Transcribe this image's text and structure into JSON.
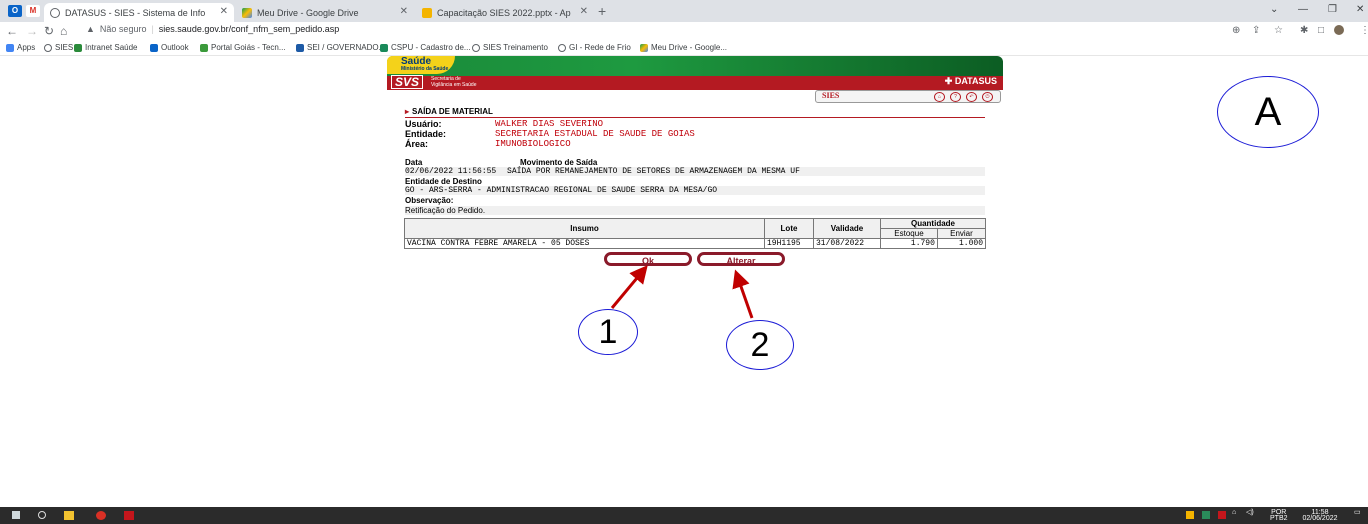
{
  "browser": {
    "tabs": [
      {
        "label": "DATASUS - SIES - Sistema de Info",
        "active": true
      },
      {
        "label": "Meu Drive - Google Drive",
        "active": false
      },
      {
        "label": "Capacitação SIES 2022.pptx - Ap",
        "active": false
      }
    ],
    "security_label": "Não seguro",
    "url": "sies.saude.gov.br/conf_nfm_sem_pedido.asp",
    "bookmarks": [
      "Apps",
      "SIES",
      "Intranet Saúde",
      "Outlook",
      "Portal Goiás - Tecn...",
      "SEI / GOVERNADO...",
      "CSPU - Cadastro de...",
      "SIES Treinamento",
      "GI - Rede de Frio",
      "Meu Drive - Google..."
    ]
  },
  "header": {
    "saude": "Saúde",
    "ministerio": "Ministério da Saúde",
    "svs": "SVS",
    "secretaria": "Secretaria de Vigilância em Saúde",
    "datasus": "DATASUS",
    "sies": "SIES"
  },
  "page": {
    "section_title": "SAÍDA DE MATERIAL",
    "usuario_label": "Usuário:",
    "usuario_value": "WALKER DIAS SEVERINO",
    "entidade_label": "Entidade:",
    "entidade_value": "SECRETARIA ESTADUAL DE SAUDE DE GOIAS",
    "area_label": "Área:",
    "area_value": "IMUNOBIOLOGICO",
    "data_label": "Data",
    "movimento_label": "Movimento de Saída",
    "data_value": "02/06/2022 11:56:55",
    "movimento_value": "SAÍDA POR REMANEJAMENTO DE SETORES DE ARMAZENAGEM DA MESMA UF",
    "destino_label": "Entidade de Destino",
    "destino_value": "GO - ARS-SERRA - ADMINISTRACAO REGIONAL DE SAUDE SERRA DA MESA/GO",
    "observacao_label": "Observação:",
    "observacao_value": "Retificação do Pedido.",
    "table": {
      "headers": {
        "insumo": "Insumo",
        "lote": "Lote",
        "validade": "Validade",
        "quantidade": "Quantidade",
        "estoque": "Estoque",
        "enviar": "Enviar"
      },
      "rows": [
        {
          "insumo": "VACINA CONTRA FEBRE AMARELA - 05 DOSES",
          "lote": "19H1195",
          "validade": "31/08/2022",
          "estoque": "1.790",
          "enviar": "1.000"
        }
      ]
    },
    "ok_button": "Ok",
    "alterar_button": "Alterar"
  },
  "annotations": {
    "a": "A",
    "one": "1",
    "two": "2"
  },
  "taskbar": {
    "lang": "POR",
    "layout": "PTB2",
    "time": "11:58",
    "date": "02/06/2022"
  }
}
